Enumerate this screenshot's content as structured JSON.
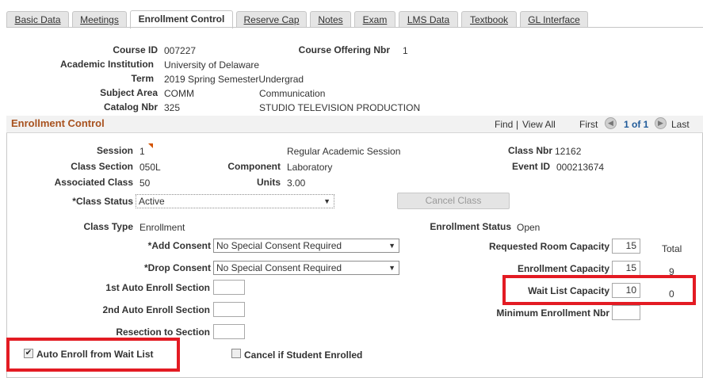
{
  "tabs": [
    {
      "label": "Basic Data",
      "active": false
    },
    {
      "label": "Meetings",
      "active": false
    },
    {
      "label": "Enrollment Control",
      "active": true
    },
    {
      "label": "Reserve Cap",
      "active": false
    },
    {
      "label": "Notes",
      "active": false
    },
    {
      "label": "Exam",
      "active": false
    },
    {
      "label": "LMS Data",
      "active": false
    },
    {
      "label": "Textbook",
      "active": false
    },
    {
      "label": "GL Interface",
      "active": false
    }
  ],
  "header": {
    "course_id_label": "Course ID",
    "course_id": "007227",
    "course_offering_label": "Course Offering Nbr",
    "course_offering": "1",
    "institution_label": "Academic Institution",
    "institution": "University of Delaware",
    "term_label": "Term",
    "term": "2019 Spring SemesterUndergrad",
    "subject_label": "Subject Area",
    "subject_code": "COMM",
    "subject_desc": "Communication",
    "catalog_label": "Catalog Nbr",
    "catalog_nbr": "325",
    "catalog_desc": "STUDIO TELEVISION PRODUCTION"
  },
  "panel": {
    "title": "Enrollment Control",
    "find": "Find",
    "sep": "|",
    "view_all": "View All",
    "first": "First",
    "counter": "1 of 1",
    "last": "Last"
  },
  "section": {
    "session_label": "Session",
    "session": "1",
    "session_desc": "Regular Academic Session",
    "class_nbr_label": "Class Nbr",
    "class_nbr": "12162",
    "class_section_label": "Class Section",
    "class_section": "050L",
    "component_label": "Component",
    "component": "Laboratory",
    "event_id_label": "Event ID",
    "event_id": "000213674",
    "assoc_class_label": "Associated Class",
    "assoc_class": "50",
    "units_label": "Units",
    "units": "3.00",
    "class_status_label": "*Class Status",
    "class_status": "Active",
    "cancel_button": "Cancel Class",
    "class_type_label": "Class Type",
    "class_type": "Enrollment",
    "enroll_status_label": "Enrollment Status",
    "enroll_status": "Open",
    "add_consent_label": "*Add Consent",
    "add_consent": "No Special Consent Required",
    "drop_consent_label": "*Drop Consent",
    "drop_consent": "No Special Consent Required",
    "auto_enroll_1_label": "1st Auto Enroll Section",
    "auto_enroll_1": "",
    "auto_enroll_2_label": "2nd Auto Enroll Section",
    "auto_enroll_2": "",
    "resection_label": "Resection to Section",
    "resection": "",
    "req_room_label": "Requested Room Capacity",
    "req_room": "15",
    "total_label": "Total",
    "enroll_cap_label": "Enrollment Capacity",
    "enroll_cap": "15",
    "enroll_total": "9",
    "waitlist_cap_label": "Wait List Capacity",
    "waitlist_cap": "10",
    "waitlist_total": "0",
    "min_enroll_label": "Minimum Enrollment Nbr",
    "min_enroll": "",
    "auto_enroll_wl_label": "Auto Enroll from Wait List",
    "auto_enroll_wl_checked": true,
    "cancel_if_enrolled_label": "Cancel if Student Enrolled",
    "cancel_if_enrolled_checked": false
  },
  "colors": {
    "panel_title": "#a8521f",
    "link": "#1f5a99",
    "highlight": "#e31b23"
  }
}
